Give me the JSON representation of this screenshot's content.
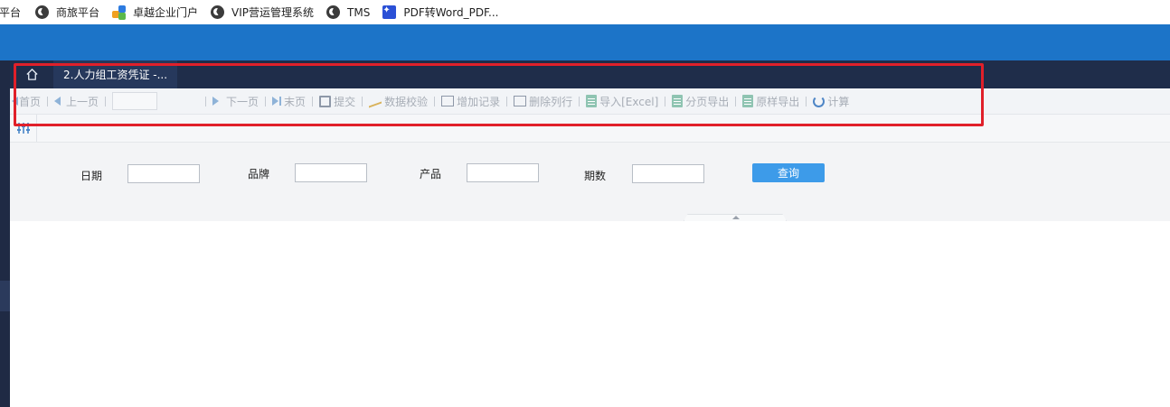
{
  "bookmarks": [
    {
      "label": "平台",
      "icon": "none"
    },
    {
      "label": "商旅平台",
      "icon": "globe-icon"
    },
    {
      "label": "卓越企业门户",
      "icon": "cube-icon"
    },
    {
      "label": "VIP营运管理系统",
      "icon": "globe-icon"
    },
    {
      "label": "TMS",
      "icon": "globe-icon"
    },
    {
      "label": "PDF转Word_PDF...",
      "icon": "pdf-icon"
    }
  ],
  "colors": {
    "header_blue": "#1c74c8",
    "tabbar_navy": "#1f2d4a",
    "query_button": "#3d9be9",
    "highlight_red": "#e0202a"
  },
  "tabs": {
    "home_icon": "home-icon",
    "active_tab_label": "2.人力组工资凭证 -..."
  },
  "toolbar": {
    "first_page": "首页",
    "prev_page": "上一页",
    "page_input_value": "",
    "next_page": "下一页",
    "last_page": "末页",
    "submit": "提交",
    "validate": "数据校验",
    "add_record": "增加记录",
    "delete_row": "删除列行",
    "import_excel": "导入[Excel]",
    "paged_export": "分页导出",
    "original_export": "原样导出",
    "calculate": "计算"
  },
  "query": {
    "fields": [
      {
        "label": "日期",
        "value": ""
      },
      {
        "label": "品牌",
        "value": ""
      },
      {
        "label": "产品",
        "value": ""
      },
      {
        "label": "期数",
        "value": ""
      }
    ],
    "submit_label": "查询"
  }
}
